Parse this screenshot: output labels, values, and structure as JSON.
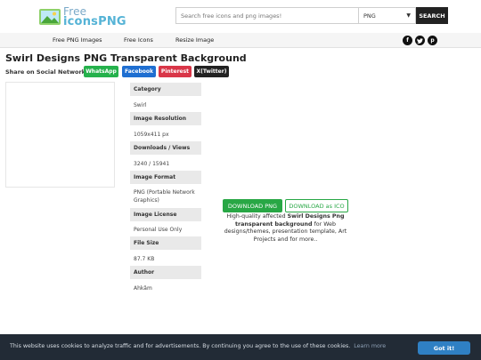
{
  "header": {
    "logo_top": "Free",
    "logo_bottom": "iconsPNG",
    "search_placeholder": "Search free icons and png images!",
    "format_selected": "PNG",
    "search_button": "SEARCH"
  },
  "nav": {
    "items": [
      "Free PNG Images",
      "Free Icons",
      "Resize Image"
    ],
    "social_icons": [
      "facebook-icon",
      "twitter-icon",
      "pinterest-icon"
    ]
  },
  "page": {
    "title": "Swirl Designs PNG Transparent Background",
    "share_label": "Share on Social Network:",
    "share_buttons": [
      {
        "label": "WhatsApp",
        "color": "#25b14c"
      },
      {
        "label": "Facebook",
        "color": "#1f6fd1"
      },
      {
        "label": "Pinterest",
        "color": "#d93648"
      },
      {
        "label": "X(Twitter)",
        "color": "#222222"
      }
    ]
  },
  "info": {
    "category_label": "Category",
    "category": "Swirl",
    "resolution_label": "Image Resolution",
    "resolution": "1059x411 px",
    "downloads_label": "Downloads / Views",
    "downloads": "3240 / 15941",
    "format_label": "Image Format",
    "format": "PNG (Portable Network Graphics)",
    "license_label": "Image License",
    "license": "Personal Use Only",
    "size_label": "File Size",
    "size": "87.7 KB",
    "author_label": "Author",
    "author": "Ahkâm"
  },
  "download": {
    "png_button": "DOWNLOAD PNG",
    "ico_button": "DOWNLOAD as ICO",
    "desc_pre": "High-quality affected",
    "desc_bold": "Swirl Designs Png transparent background",
    "desc_post": "for Web designs/themes, presentation template, Art Projects and for more.."
  },
  "cookie": {
    "text": "This website uses cookies to analyze traffic and for advertisements. By continuing you agree to the use of these cookies.",
    "link": "Learn more",
    "button": "Got it!"
  }
}
